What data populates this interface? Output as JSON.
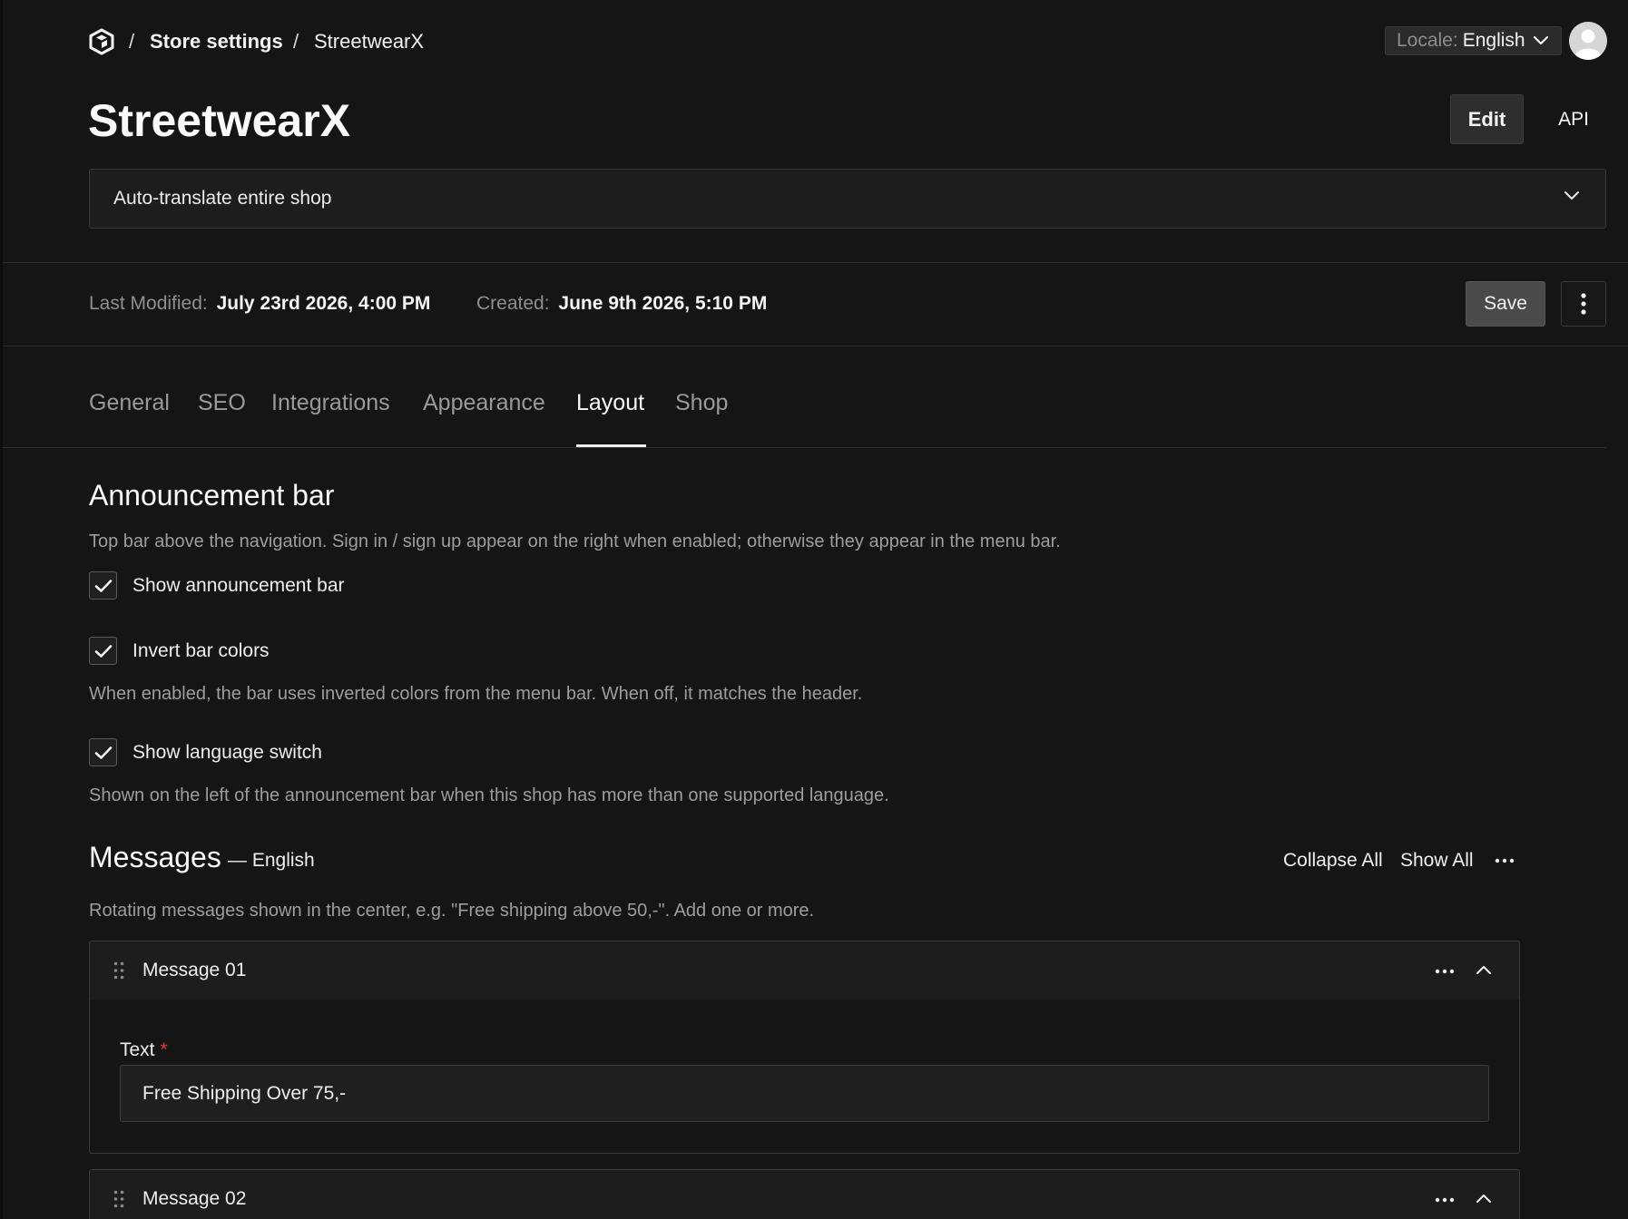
{
  "header": {
    "breadcrumb": [
      "Store settings",
      "StreetwearX"
    ],
    "locale_label": "Locale:",
    "locale_value": "English",
    "logo_icon": "hexagon-logo-icon",
    "avatar_icon": "user-avatar-icon"
  },
  "page": {
    "title": "StreetwearX",
    "edit_label": "Edit",
    "api_label": "API",
    "translate_option": "Auto-translate entire shop"
  },
  "meta": {
    "last_modified_label": "Last Modified:",
    "last_modified_value": "July 23rd 2026, 4:00 PM",
    "created_label": "Created:",
    "created_value": "June 9th 2026, 5:10 PM",
    "save_label": "Save"
  },
  "tabs": [
    {
      "label": "General",
      "active": false
    },
    {
      "label": "SEO",
      "active": false
    },
    {
      "label": "Integrations",
      "active": false
    },
    {
      "label": "Appearance",
      "active": false
    },
    {
      "label": "Layout",
      "active": true
    },
    {
      "label": "Shop",
      "active": false
    }
  ],
  "announcement": {
    "title": "Announcement bar",
    "description": "Top bar above the navigation. Sign in / sign up appear on the right when enabled; otherwise they appear in the menu bar.",
    "options": [
      {
        "label": "Show announcement bar",
        "checked": true,
        "help": ""
      },
      {
        "label": "Invert bar colors",
        "checked": true,
        "help": "When enabled, the bar uses inverted colors from the menu bar. When off, it matches the header."
      },
      {
        "label": "Show language switch",
        "checked": true,
        "help": "Shown on the left of the announcement bar when this shop has more than one supported language."
      }
    ]
  },
  "messages": {
    "title": "Messages",
    "subtitle": "— English",
    "collapse_all": "Collapse All",
    "show_all": "Show All",
    "description": "Rotating messages shown in the center, e.g. \"Free shipping above 50,-\". Add one or more.",
    "items": [
      {
        "name": "Message 01",
        "field_label": "Text",
        "required_mark": "*",
        "value": "Free Shipping Over 75,-",
        "expanded": true
      },
      {
        "name": "Message 02",
        "expanded": true
      }
    ]
  },
  "colors": {
    "background": "#151515",
    "accent_text": "#fafafa",
    "muted_text": "#9d9d9d",
    "required": "#e03b3b"
  }
}
